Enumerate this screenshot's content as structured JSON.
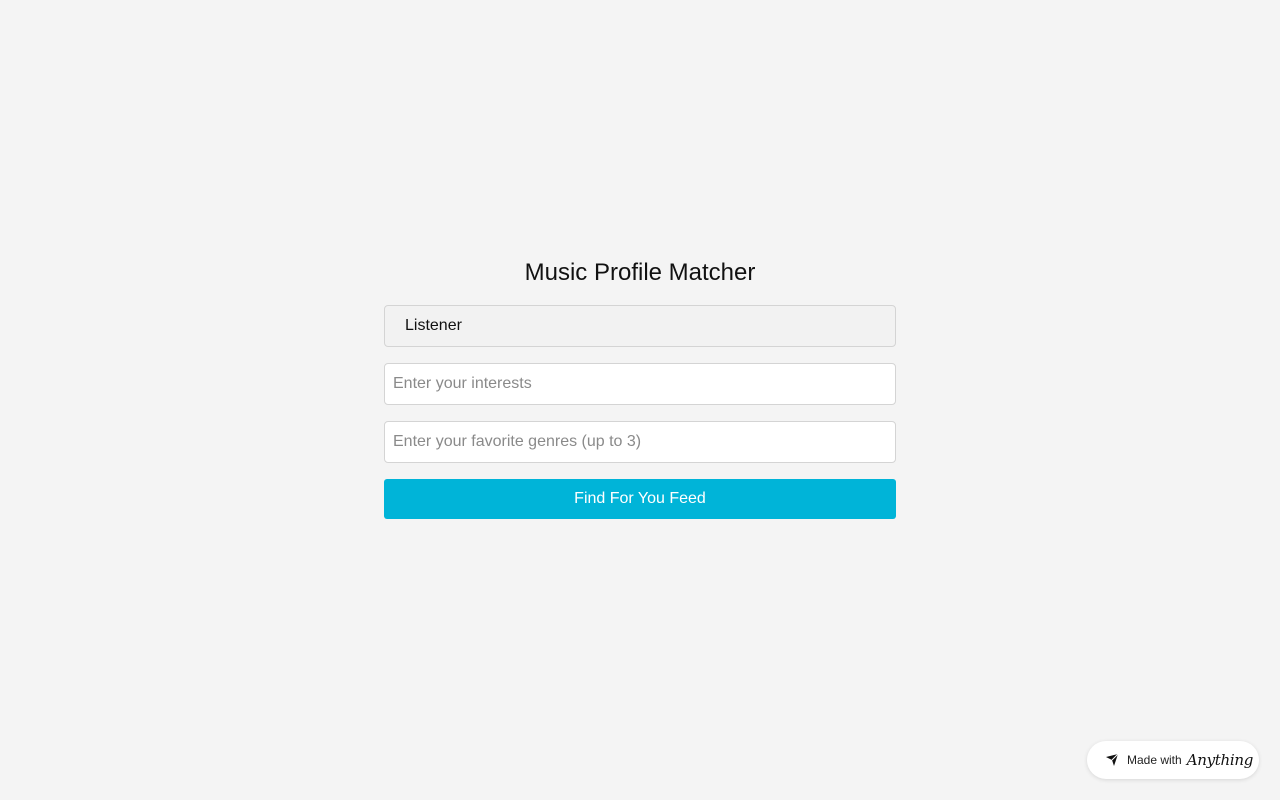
{
  "app": {
    "title": "Music Profile Matcher"
  },
  "form": {
    "role_select": {
      "selected": "Listener"
    },
    "interests": {
      "value": "",
      "placeholder": "Enter your interests"
    },
    "genres": {
      "value": "",
      "placeholder": "Enter your favorite genres (up to 3)"
    },
    "submit_label": "Find For You Feed"
  },
  "badge": {
    "prefix": "Made with",
    "brand": "Anything",
    "icon": "anything-logo-icon"
  },
  "colors": {
    "accent": "#00b4d8",
    "background": "#f4f4f4"
  }
}
